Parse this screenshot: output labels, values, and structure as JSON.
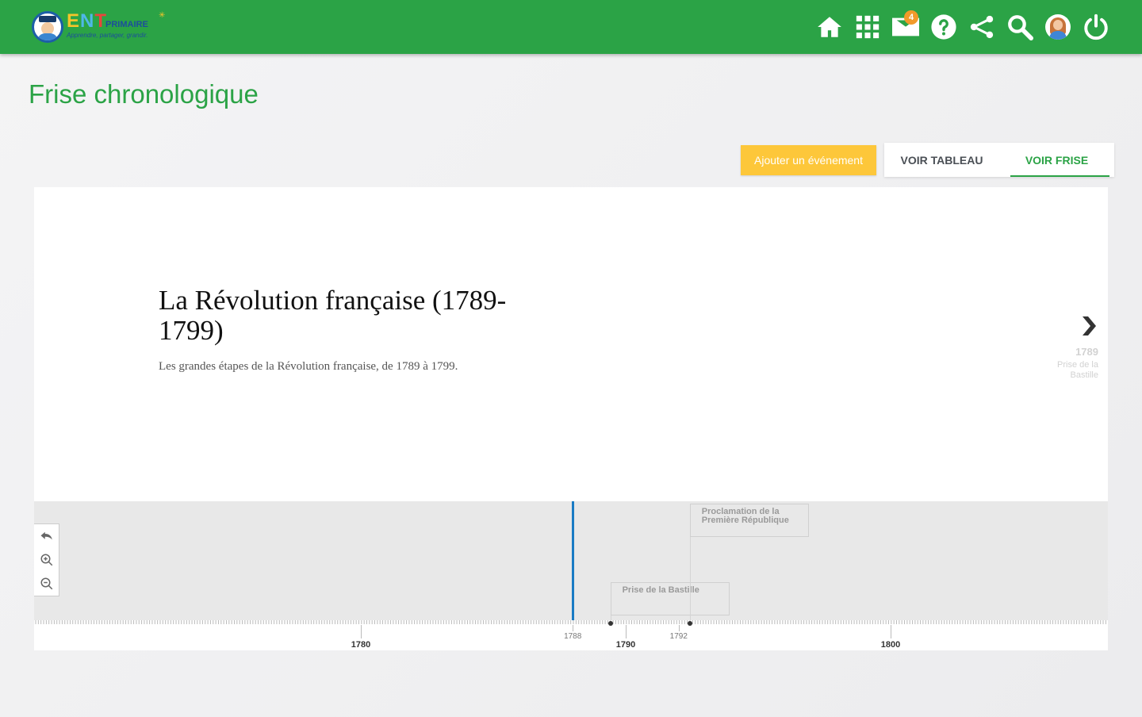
{
  "header": {
    "logo": {
      "word_e": "E",
      "word_n": "N",
      "word_t": "T",
      "primaire": "PRIMAIRE",
      "tagline": "Apprendre, partager, grandir."
    },
    "nav": [
      {
        "id": "home",
        "icon": "home-icon"
      },
      {
        "id": "apps",
        "icon": "apps-grid-icon"
      },
      {
        "id": "messages",
        "icon": "mail-icon",
        "badge": "4"
      },
      {
        "id": "help",
        "icon": "help-icon"
      },
      {
        "id": "share",
        "icon": "share-icon"
      },
      {
        "id": "search",
        "icon": "search-icon"
      },
      {
        "id": "profile",
        "icon": "avatar"
      },
      {
        "id": "logout",
        "icon": "power-icon"
      }
    ]
  },
  "page": {
    "title": "Frise chronologique"
  },
  "actions": {
    "add_event": "Ajouter un événement",
    "tab_table": "VOIR TABLEAU",
    "tab_timeline": "VOIR FRISE",
    "active_tab": "VOIR FRISE"
  },
  "story": {
    "title": "La Révolution française (1789-1799)",
    "description": "Les grandes étapes de la Révolution française, de 1789 à 1799.",
    "next": {
      "date": "1789",
      "label": "Prise de la Bastille"
    }
  },
  "timeline": {
    "events": [
      {
        "year": 1789,
        "label": "Prise de la Bastille"
      },
      {
        "year": 1792,
        "label": "Proclamation de la Première République"
      }
    ],
    "axis": {
      "major": [
        1780,
        1790,
        1800
      ],
      "minor": [
        1788,
        1792
      ]
    },
    "current_year": 1788
  },
  "colors": {
    "brand_green": "#2ba346",
    "button_yellow": "#fdc73a",
    "timeline_blue": "#1a7bc4",
    "badge_orange": "#f19a2a"
  }
}
